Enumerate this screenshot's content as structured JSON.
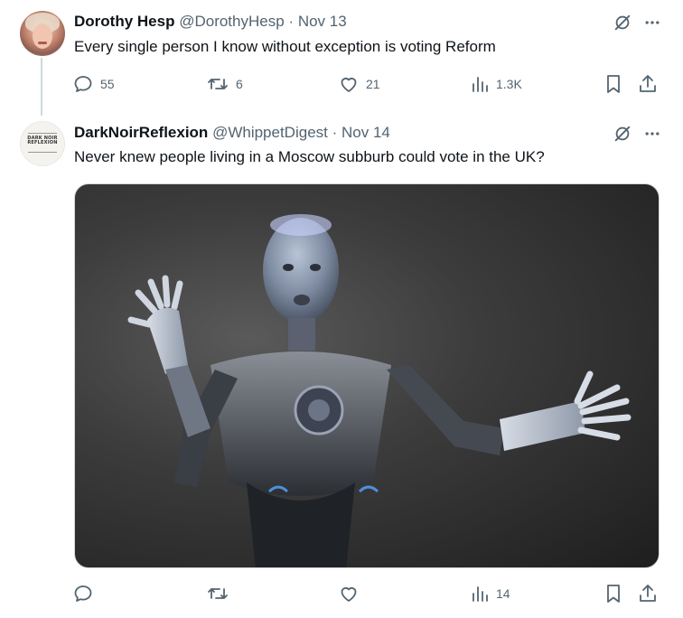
{
  "tweets": [
    {
      "name": "Dorothy Hesp",
      "handle": "@DorothyHesp",
      "separator": "·",
      "date": "Nov 13",
      "text": "Every single person I know without exception is voting Reform",
      "actions": {
        "replies": "55",
        "retweets": "6",
        "likes": "21",
        "views": "1.3K"
      }
    },
    {
      "name": "DarkNoirReflexion",
      "handle": "@WhippetDigest",
      "separator": "·",
      "date": "Nov 14",
      "text": "Never knew people living in a Moscow subburb could vote in the UK?",
      "avatar_logo_text": "DARK NOIR REFLEXION",
      "actions": {
        "replies": "",
        "retweets": "",
        "likes": "",
        "views": "14"
      },
      "media": {
        "icon": "humanoid-robot-photo"
      }
    }
  ],
  "icons": {
    "grok": "grok-icon",
    "more": "more-icon",
    "reply": "reply-icon",
    "retweet": "retweet-icon",
    "like": "like-icon",
    "views": "views-icon",
    "bookmark": "bookmark-icon",
    "share": "share-icon"
  },
  "colors": {
    "text_primary": "#0f1419",
    "text_secondary": "#536471",
    "border": "#cfd9de"
  }
}
